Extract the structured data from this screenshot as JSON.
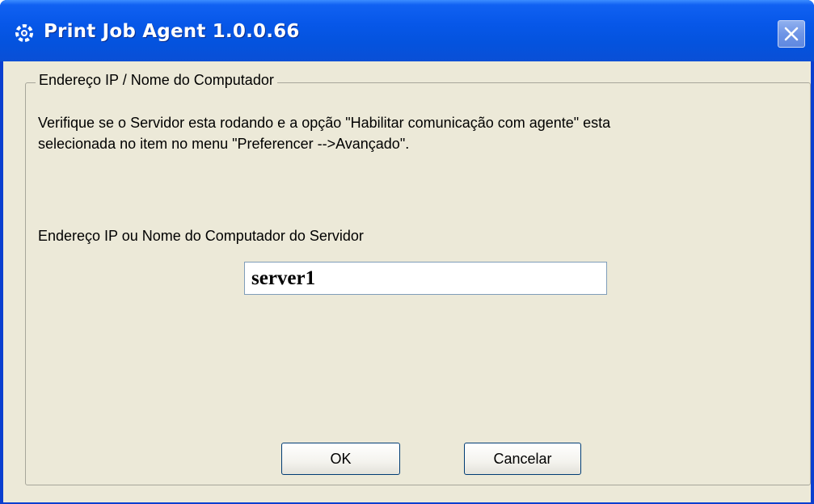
{
  "window": {
    "title": "Print Job Agent 1.0.0.66",
    "icon": "print-agent-icon",
    "close_icon": "close-icon"
  },
  "group": {
    "legend": "Endereço IP / Nome do Computador",
    "instruction_line1": "Verifique se o Servidor esta rodando e a opção \"Habilitar comunicação com agente\" esta",
    "instruction_line2": "selecionada no item no menu \"Preferencer -->Avançado\".",
    "server_label": "Endereço IP ou Nome do Computador do Servidor",
    "server_value": "server1"
  },
  "buttons": {
    "ok_label": "OK",
    "cancel_label": "Cancelar"
  },
  "colors": {
    "titlebar": "#0757e8",
    "client_bg": "#ece9d8",
    "input_border": "#7f9db9"
  }
}
